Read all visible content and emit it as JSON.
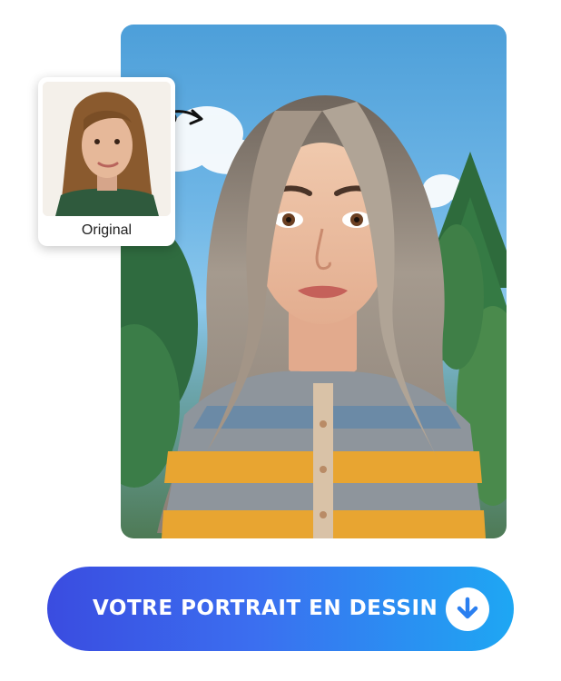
{
  "original_card": {
    "label": "Original"
  },
  "main_portrait": {
    "style": "3D cartoon portrait"
  },
  "cta": {
    "label": "VOTRE PORTRAIT EN DESSIN",
    "icon": "download-arrow-icon"
  },
  "colors": {
    "cta_gradient_start": "#3a4ce0",
    "cta_gradient_end": "#1ea7f3",
    "sky": "#5aa9dd",
    "sweater_yellow": "#e8a531",
    "sweater_gray": "#8e959c",
    "hair": "#9a8d80"
  }
}
